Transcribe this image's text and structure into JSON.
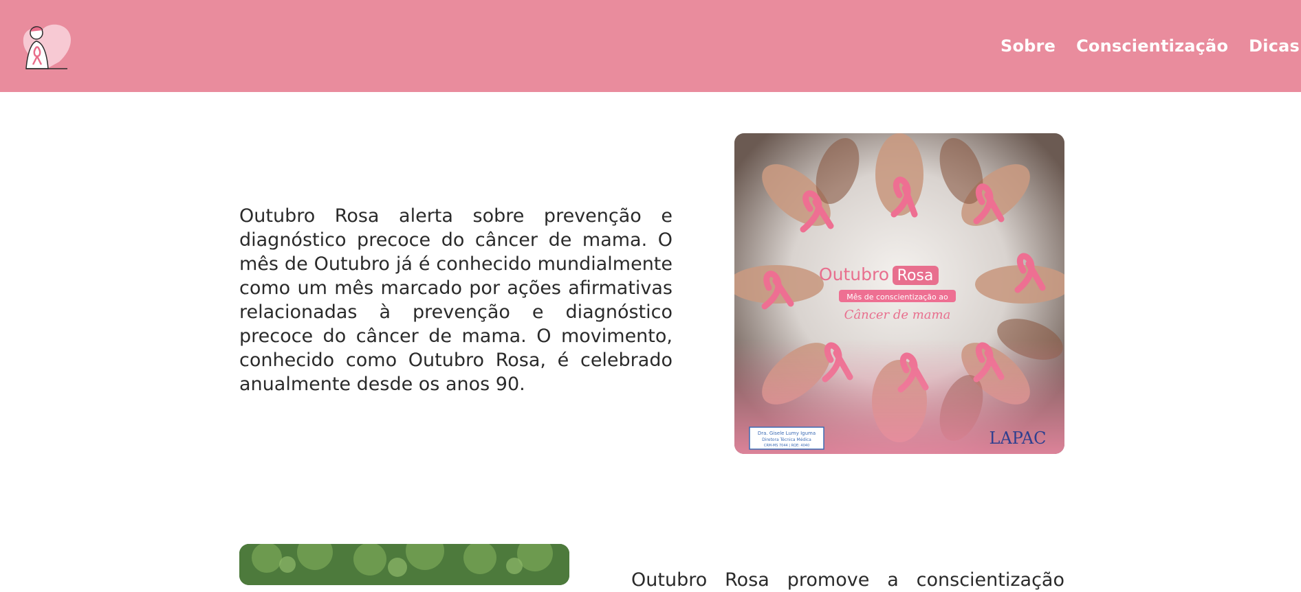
{
  "header": {
    "logo_icon": "pink-ribbon-heart-logo-icon",
    "brand_color": "#e98c9d",
    "nav": [
      {
        "label": "Sobre"
      },
      {
        "label": "Conscientização"
      },
      {
        "label": "Dicas"
      }
    ]
  },
  "section1": {
    "paragraph": "Outubro Rosa alerta sobre prevenção e diagnóstico precoce do câncer de mama. O mês de Outubro já é conhecido mundialmente como um mês marcado por ações afirmativas relacionadas à prevenção e diagnóstico precoce do câncer de mama. O movimento, conhecido como Outubro Rosa, é celebrado anualmente desde os anos 90.",
    "image": {
      "title_word1": "Outubro",
      "title_word2": "Rosa",
      "subtitle": "Mês de conscientização ao",
      "script_text": "Câncer de mama",
      "doctor_line1": "Dra. Gisele Lumy Iguma",
      "doctor_line2": "Diretora Técnica Médica",
      "doctor_line3": "CRM-MS 7044 | RQE: 4040",
      "brand": "LAPAC"
    }
  },
  "section2": {
    "paragraph_start": "Outubro Rosa promove a conscientização"
  }
}
